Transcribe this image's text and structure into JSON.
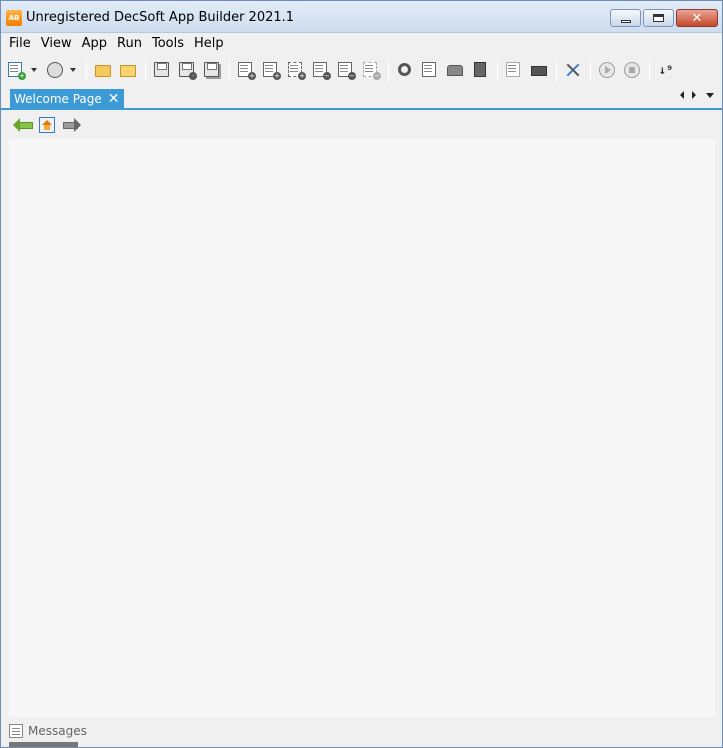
{
  "window": {
    "title": "Unregistered DecSoft App Builder 2021.1",
    "logo_text": "AB",
    "controls": {
      "minimize": "minimize",
      "maximize": "maximize",
      "close": "✕"
    }
  },
  "menu": {
    "items": [
      {
        "label": "File"
      },
      {
        "label": "View"
      },
      {
        "label": "App"
      },
      {
        "label": "Run"
      },
      {
        "label": "Tools"
      },
      {
        "label": "Help"
      }
    ]
  },
  "toolbar": {
    "buttons": [
      {
        "name": "new-app-icon"
      },
      {
        "name": "open-recent-icon"
      },
      {
        "name": "open-folder-icon"
      },
      {
        "name": "open-app-folder-icon"
      },
      {
        "name": "save-icon"
      },
      {
        "name": "save-as-icon"
      },
      {
        "name": "save-all-icon"
      },
      {
        "name": "new-view-icon"
      },
      {
        "name": "new-dialog-icon"
      },
      {
        "name": "new-frame-icon"
      },
      {
        "name": "remove-view-icon"
      },
      {
        "name": "remove-dialog-icon"
      },
      {
        "name": "remove-frame-icon"
      },
      {
        "name": "app-properties-icon"
      },
      {
        "name": "edit-icon"
      },
      {
        "name": "package-icon"
      },
      {
        "name": "device-icon"
      },
      {
        "name": "back-icon"
      },
      {
        "name": "print-icon"
      },
      {
        "name": "tools-icon"
      },
      {
        "name": "run-icon"
      },
      {
        "name": "stop-icon"
      },
      {
        "name": "sort-icon"
      }
    ],
    "sort_glyph": "↓⁹"
  },
  "tabs": {
    "active": {
      "label": "Welcome Page",
      "close": "✕"
    }
  },
  "bottom": {
    "messages_label": "Messages"
  },
  "colors": {
    "accent": "#3c9bd6",
    "content_bg": "#f7f7f7",
    "chrome_bg": "#f0f0f0"
  }
}
